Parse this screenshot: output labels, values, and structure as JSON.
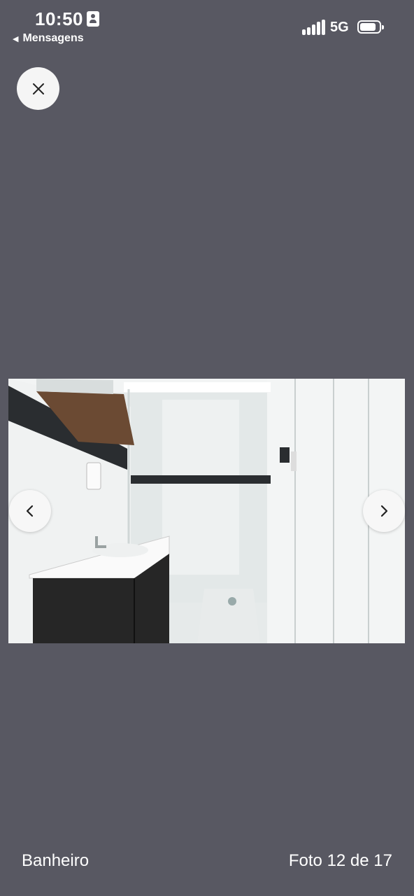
{
  "status_bar": {
    "time": "10:50",
    "back_app": "Mensagens",
    "network": "5G",
    "icons": [
      "id-card-icon",
      "signal-icon",
      "battery-icon"
    ]
  },
  "viewer": {
    "close_icon": "close-icon",
    "prev_icon": "chevron-left-icon",
    "next_icon": "chevron-right-icon",
    "caption": "Banheiro",
    "counter": "Foto 12 de 17",
    "current_photo": 12,
    "total_photos": 17
  },
  "colors": {
    "background": "#585862",
    "button": "#f5f5f5",
    "text": "#ffffff"
  }
}
